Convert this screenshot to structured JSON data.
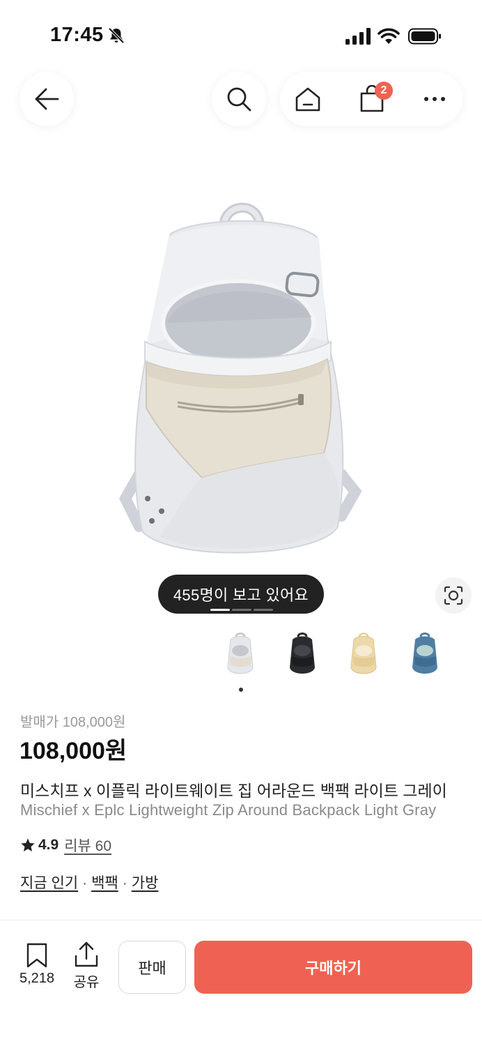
{
  "status_bar": {
    "time": "17:45",
    "icons": [
      "bell-slash-icon",
      "signal-icon",
      "wifi-icon",
      "battery-icon"
    ]
  },
  "nav": {
    "back_icon": "arrow-left-icon",
    "search_icon": "search-icon",
    "home_icon": "home-icon",
    "cart_icon": "shopping-bag-icon",
    "cart_badge": "2",
    "more_icon": "more-horizontal-icon"
  },
  "product": {
    "viewers_text": "455명이 보고 있어요",
    "image_count": 3,
    "current_image": 1,
    "color_options": [
      {
        "name": "light-gray",
        "color": "#e4e6ea"
      },
      {
        "name": "black",
        "color": "#2a2b2f"
      },
      {
        "name": "beige",
        "color": "#e9d4a2"
      },
      {
        "name": "blue",
        "color": "#4f7ea2"
      }
    ],
    "selected_color_index": 0,
    "original_price": "발매가 108,000원",
    "price": "108,000원",
    "title_kr": "미스치프 x 이플릭 라이트웨이트 집 어라운드 백팩 라이트 그레이",
    "title_en": "Mischief x Eplc Lightweight Zip Around Backpack Light Gray",
    "rating": "4.9",
    "reviews": "리뷰 60",
    "categories": [
      "지금 인기",
      "백팩",
      "가방"
    ],
    "category_separator": "·"
  },
  "bottom_bar": {
    "bookmark_count": "5,218",
    "share_label": "공유",
    "sell_label": "판매",
    "buy_label": "구매하기"
  },
  "colors": {
    "accent": "#ef6253",
    "text": "#222222",
    "muted": "#9a9a9a",
    "pill": "#222222"
  }
}
